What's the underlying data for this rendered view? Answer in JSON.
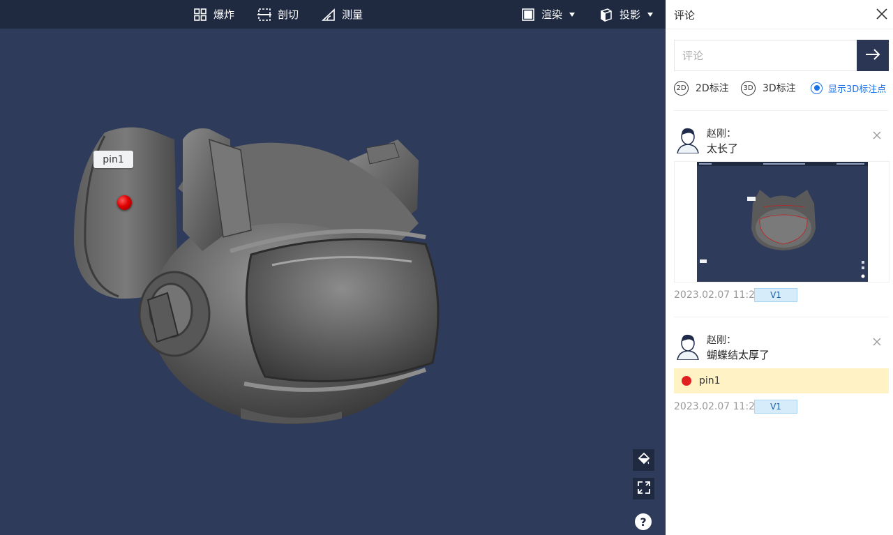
{
  "toolbar": {
    "explode": {
      "label": "爆炸",
      "icon": "explode-icon"
    },
    "section": {
      "label": "剖切",
      "icon": "section-icon"
    },
    "measure": {
      "label": "测量",
      "icon": "measure-icon"
    },
    "render": {
      "label": "渲染",
      "icon": "render-icon"
    },
    "projection": {
      "label": "投影",
      "icon": "projection-icon"
    }
  },
  "viewer": {
    "pin_label": "pin1",
    "pin_color": "#e00000",
    "background": "#2f3b5b",
    "side_buttons": [
      "paint-bucket-icon",
      "fullscreen-icon"
    ],
    "help_label": "?"
  },
  "panel": {
    "title": "评论",
    "input_placeholder": "评论",
    "marks": {
      "mark2d_icon": "2D",
      "mark2d_label": "2D标注",
      "mark3d_icon": "3D",
      "mark3d_label": "3D标注",
      "show3d_label": "显示3D标注点",
      "show3d_selected": true
    },
    "accent": "#1a73e8",
    "comments": [
      {
        "author": "赵刚：",
        "text": "太长了",
        "has_screenshot": true,
        "time": "2023.02.07 11:20",
        "version": "V1"
      },
      {
        "author": "赵刚：",
        "text": "蝴蝶结太厚了",
        "pin": "pin1",
        "time": "2023.02.07 11:20",
        "version": "V1"
      }
    ]
  }
}
